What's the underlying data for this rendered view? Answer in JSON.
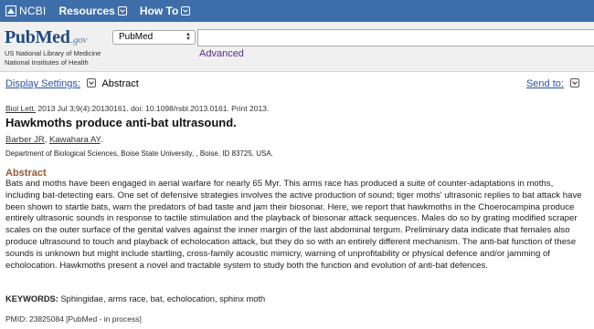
{
  "topbar": {
    "ncbi_label": "NCBI",
    "resources_label": "Resources",
    "howto_label": "How To"
  },
  "header": {
    "logo_pub": "Pub",
    "logo_med": "Med",
    "logo_gov": ".gov",
    "logo_line1": "US National Library of Medicine",
    "logo_line2": "National Institutes of Health",
    "db_selected": "PubMed",
    "search_value": "",
    "advanced_label": "Advanced"
  },
  "display": {
    "settings_label": "Display Settings:",
    "format_value": "Abstract",
    "sendto_label": "Send to:"
  },
  "article": {
    "journal": "Biol Lett.",
    "citation": " 2013 Jul 3;9(4):20130161. doi: 10.1098/rsbl.2013.0161. Print 2013.",
    "title": "Hawkmoths produce anti-bat ultrasound.",
    "author1": "Barber JR",
    "author_sep": ", ",
    "author2": "Kawahara AY",
    "author_end": ".",
    "affiliation": "Department of Biological Sciences, Boise State University, , Boise, ID 83725, USA.",
    "abstract_heading": "Abstract",
    "abstract_lines": [
      "Bats and moths have been engaged in aerial warfare for nearly 65 Myr. This arms race has produced a suite of counter-adaptations in moths,",
      "including bat-detecting ears. One set of defensive strategies involves the active production of sound; tiger moths' ultrasonic replies to bat attack have",
      "been shown to startle bats, warn the predators of bad taste and jam their biosonar. Here, we report that hawkmoths in the Choerocampina produce",
      "entirely ultrasonic sounds in response to tactile stimulation and the playback of biosonar attack sequences. Males do so by grating modified scraper",
      "scales on the outer surface of the genital valves against the inner margin of the last abdominal tergum. Preliminary data indicate that females also",
      "produce ultrasound to touch and playback of echolocation attack, but they do so with an entirely different mechanism. The anti-bat function of these",
      "sounds is unknown but might include startling, cross-family acoustic mimicry, warning of unprofitability or physical defence and/or jamming of",
      "echolocation. Hawkmoths present a novel and tractable system to study both the function and evolution of anti-bat defences."
    ],
    "keywords_label": "KEYWORDS:",
    "keywords_value": " Sphingidae, arms race, bat, echolocation, sphinx moth",
    "pmid_text": "PMID: 23825084 [PubMed - in process]"
  },
  "colors": {
    "topbar": "#3e6ea9",
    "link": "#2a52a3",
    "abstract_heading": "#985735",
    "visited_link": "#5c2f8c"
  }
}
